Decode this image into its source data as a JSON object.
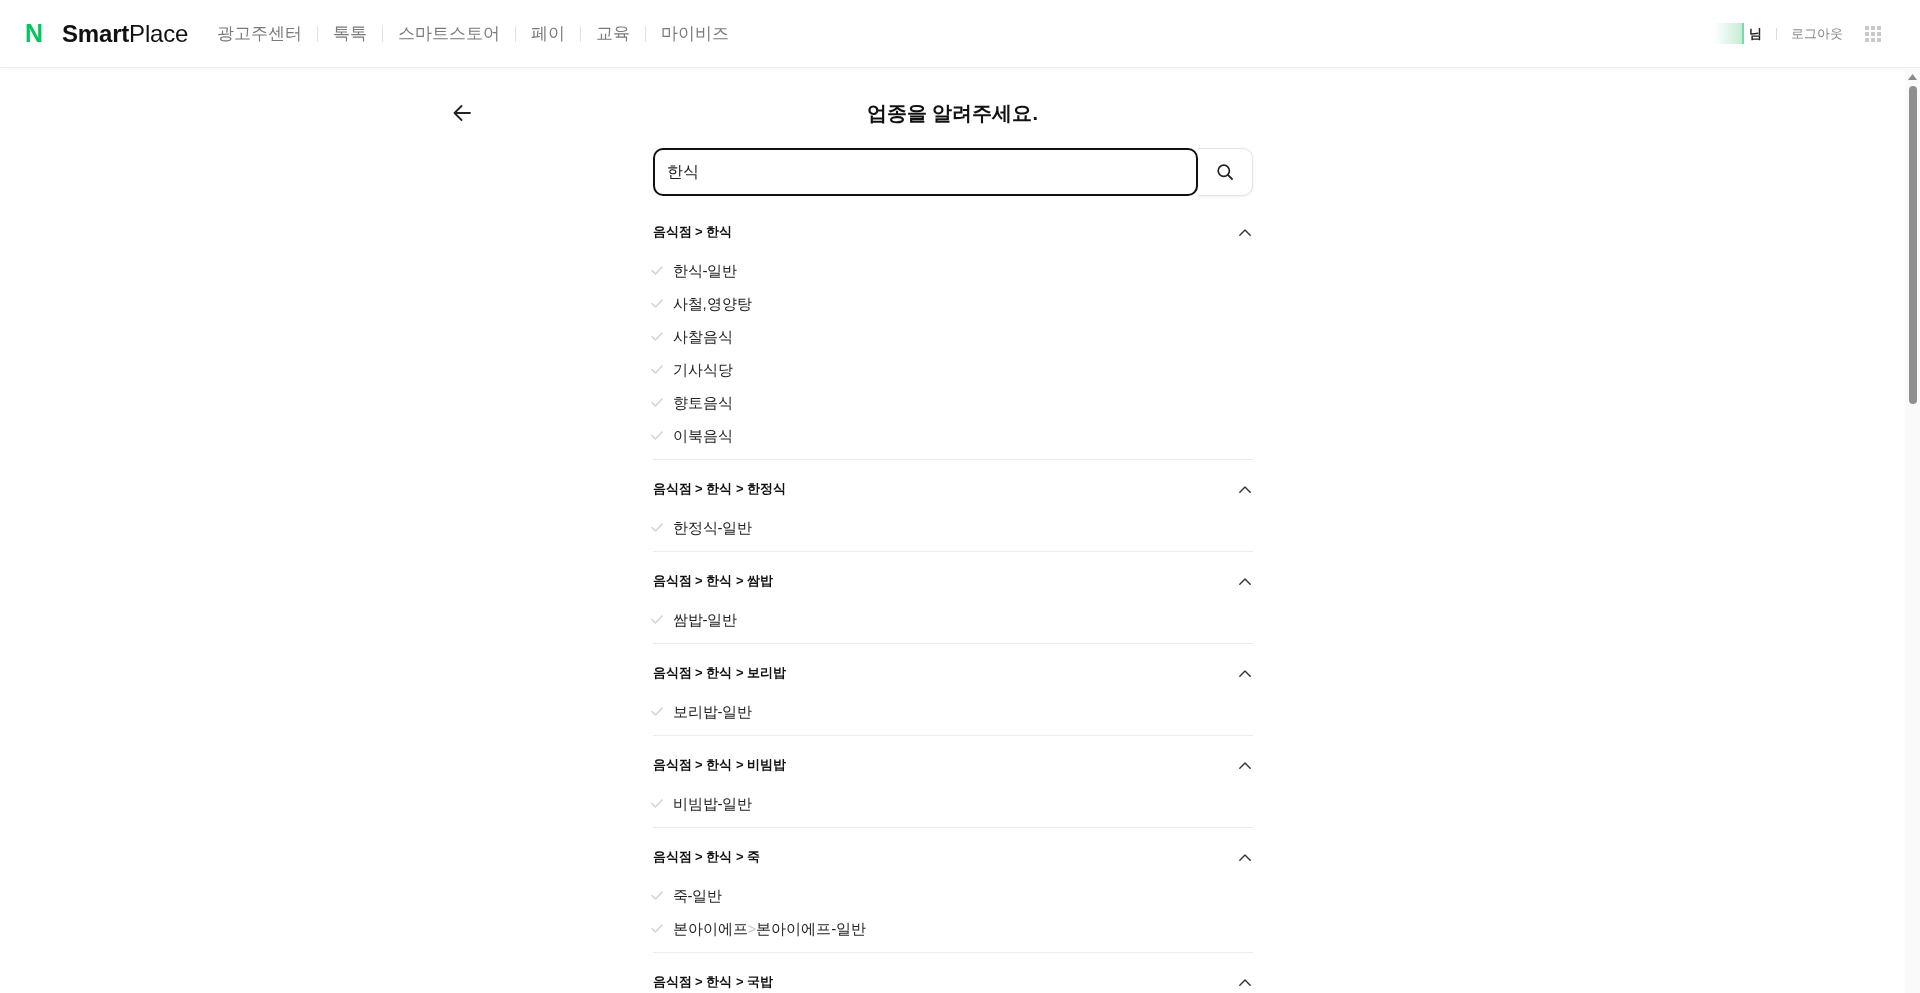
{
  "header": {
    "logo": {
      "mark": "N",
      "name": "**Smart**Place"
    },
    "nav": [
      "광고주센터",
      "톡톡",
      "스마트스토어",
      "페이",
      "교육",
      "마이비즈"
    ],
    "user_suffix": "님",
    "logout": "로그아웃"
  },
  "title": "업종을 알려주세요.",
  "search": {
    "value": "한식"
  },
  "groups": [
    {
      "path": "음식점 > 한식",
      "expanded": true,
      "items": [
        {
          "label": "한식-일반",
          "selected": false
        },
        {
          "label": "사철,영양탕",
          "selected": false
        },
        {
          "label": "사찰음식",
          "selected": false
        },
        {
          "label": "기사식당",
          "selected": false
        },
        {
          "label": "향토음식",
          "selected": false
        },
        {
          "label": "이북음식",
          "selected": false
        }
      ]
    },
    {
      "path": "음식점 > 한식 > 한정식",
      "expanded": true,
      "items": [
        {
          "label": "한정식-일반",
          "selected": false
        }
      ]
    },
    {
      "path": "음식점 > 한식 > 쌈밥",
      "expanded": true,
      "items": [
        {
          "label": "쌈밥-일반",
          "selected": false
        }
      ]
    },
    {
      "path": "음식점 > 한식 > 보리밥",
      "expanded": true,
      "items": [
        {
          "label": "보리밥-일반",
          "selected": false
        }
      ]
    },
    {
      "path": "음식점 > 한식 > 비빔밥",
      "expanded": true,
      "items": [
        {
          "label": "비빔밥-일반",
          "selected": false
        }
      ]
    },
    {
      "path": "음식점 > 한식 > 죽",
      "expanded": true,
      "items": [
        {
          "label": "죽-일반",
          "selected": false
        },
        {
          "brand": "본아이에프",
          "separator": ">",
          "label": "본아이에프-일반",
          "selected": false
        }
      ]
    },
    {
      "path": "음식점 > 한식 > 국밥",
      "expanded": true
    }
  ]
}
